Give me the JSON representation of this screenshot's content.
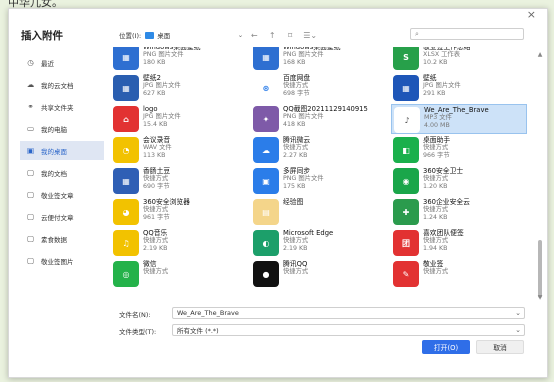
{
  "bg_text": "中华儿女。",
  "dialog": {
    "title": "插入附件",
    "close_glyph": "×",
    "sidebar": [
      {
        "icon": "clock-icon",
        "glyph": "◷",
        "label": "最近",
        "active": false
      },
      {
        "icon": "cloud-icon",
        "glyph": "☁",
        "label": "我的云文档",
        "active": false
      },
      {
        "icon": "share-icon",
        "glyph": "⚭",
        "label": "共享文件夹",
        "active": false
      },
      {
        "icon": "computer-icon",
        "glyph": "▭",
        "label": "我的电脑",
        "active": false
      },
      {
        "icon": "desktop-icon",
        "glyph": "▣",
        "label": "我的桌面",
        "active": true
      },
      {
        "icon": "folder-icon",
        "glyph": "▢",
        "label": "我的文档",
        "active": false
      },
      {
        "icon": "folder-icon",
        "glyph": "▢",
        "label": "敬业签文章",
        "active": false
      },
      {
        "icon": "folder-icon",
        "glyph": "▢",
        "label": "云便付文章",
        "active": false
      },
      {
        "icon": "folder-icon",
        "glyph": "▢",
        "label": "素食数据",
        "active": false
      },
      {
        "icon": "folder-icon",
        "glyph": "▢",
        "label": "敬业签图片",
        "active": false
      }
    ],
    "toolbar": {
      "location_label": "位置(I):",
      "location_value": "桌面",
      "dropdown_glyph": "⌄",
      "back_glyph": "←",
      "up_glyph": "↑",
      "newfolder_glyph": "⌑",
      "view_glyph": "☰⌄",
      "search_icon": "search-icon",
      "search_glyph": "⌕"
    },
    "files": [
      {
        "name": "Windows桌面壁纸",
        "type": "PNG 图片文件",
        "size": "180 KB",
        "color": "#2e6fd1",
        "glyph": "▦"
      },
      {
        "name": "Windows桌面壁纸",
        "type": "PNG 图片文件",
        "size": "168 KB",
        "color": "#2e6fd1",
        "glyph": "▦"
      },
      {
        "name": "敬业签工作总结",
        "type": "XLSX 工作表",
        "size": "10.2 KB",
        "color": "#27a04a",
        "glyph": "S"
      },
      {
        "name": "壁纸2",
        "type": "JPG 图片文件",
        "size": "627 KB",
        "color": "#2a5eb0",
        "glyph": "▦"
      },
      {
        "name": "百度网盘",
        "type": "快捷方式",
        "size": "698 字节",
        "color": "#ffffff",
        "glyph": "⊛",
        "fg": "#2b7de9"
      },
      {
        "name": "壁纸",
        "type": "JPG 图片文件",
        "size": "291 KB",
        "color": "#1e56b8",
        "glyph": "▦"
      },
      {
        "name": "logo",
        "type": "JPG 图片文件",
        "size": "15.4 KB",
        "color": "#e23232",
        "glyph": "⌂"
      },
      {
        "name": "QQ截图20211129140915",
        "type": "PNG 图片文件",
        "size": "418 KB",
        "color": "#7e5aa8",
        "glyph": "✦"
      },
      {
        "name": "We_Are_The_Brave",
        "type": "MP3 文件",
        "size": "4.00 MB",
        "color": "#ffffff",
        "glyph": "♪",
        "fg": "#555",
        "selected": true
      },
      {
        "name": "会议录音",
        "type": "WAV 文件",
        "size": "113 KB",
        "color": "#f2c200",
        "glyph": "◔"
      },
      {
        "name": "腾讯微云",
        "type": "快捷方式",
        "size": "2.27 KB",
        "color": "#2b7de9",
        "glyph": "☁"
      },
      {
        "name": "桌面助手",
        "type": "快捷方式",
        "size": "966 字节",
        "color": "#1ab04c",
        "glyph": "◧"
      },
      {
        "name": "香肠土豆",
        "type": "快捷方式",
        "size": "690 字节",
        "color": "#2f5fb5",
        "glyph": "▦"
      },
      {
        "name": "多屏同步",
        "type": "PNG 图片文件",
        "size": "175 KB",
        "color": "#2b7de9",
        "glyph": "▣"
      },
      {
        "name": "360安全卫士",
        "type": "快捷方式",
        "size": "1.20 KB",
        "color": "#1aa64a",
        "glyph": "◉"
      },
      {
        "name": "360安全浏览器",
        "type": "快捷方式",
        "size": "961 字节",
        "color": "#f2c200",
        "glyph": "◕"
      },
      {
        "name": "经验图",
        "type": "",
        "size": "",
        "color": "#f4d58a",
        "glyph": "▤"
      },
      {
        "name": "360企业安全云",
        "type": "快捷方式",
        "size": "1.24 KB",
        "color": "#2b9b4d",
        "glyph": "✚"
      },
      {
        "name": "QQ音乐",
        "type": "快捷方式",
        "size": "2.19 KB",
        "color": "#f2c200",
        "glyph": "♫"
      },
      {
        "name": "Microsoft Edge",
        "type": "快捷方式",
        "size": "2.19 KB",
        "color": "#1c9f6a",
        "glyph": "◐"
      },
      {
        "name": "喜欢团队便签",
        "type": "快捷方式",
        "size": "1.94 KB",
        "color": "#e23232",
        "glyph": "团"
      },
      {
        "name": "微信",
        "type": "快捷方式",
        "size": "",
        "color": "#24b24a",
        "glyph": "◎"
      },
      {
        "name": "腾讯QQ",
        "type": "快捷方式",
        "size": "",
        "color": "#111111",
        "glyph": "●"
      },
      {
        "name": "敬业签",
        "type": "快捷方式",
        "size": "",
        "color": "#e23232",
        "glyph": "✎"
      }
    ],
    "filename_label": "文件名(N):",
    "filename_value": "We_Are_The_Brave",
    "filetype_label": "文件类型(T):",
    "filetype_value": "所有文件 (*.*)",
    "open_label": "打开(O)",
    "cancel_label": "取消",
    "scroll_up": "▲",
    "scroll_down": "▼",
    "accent": "#2f6ee8"
  }
}
